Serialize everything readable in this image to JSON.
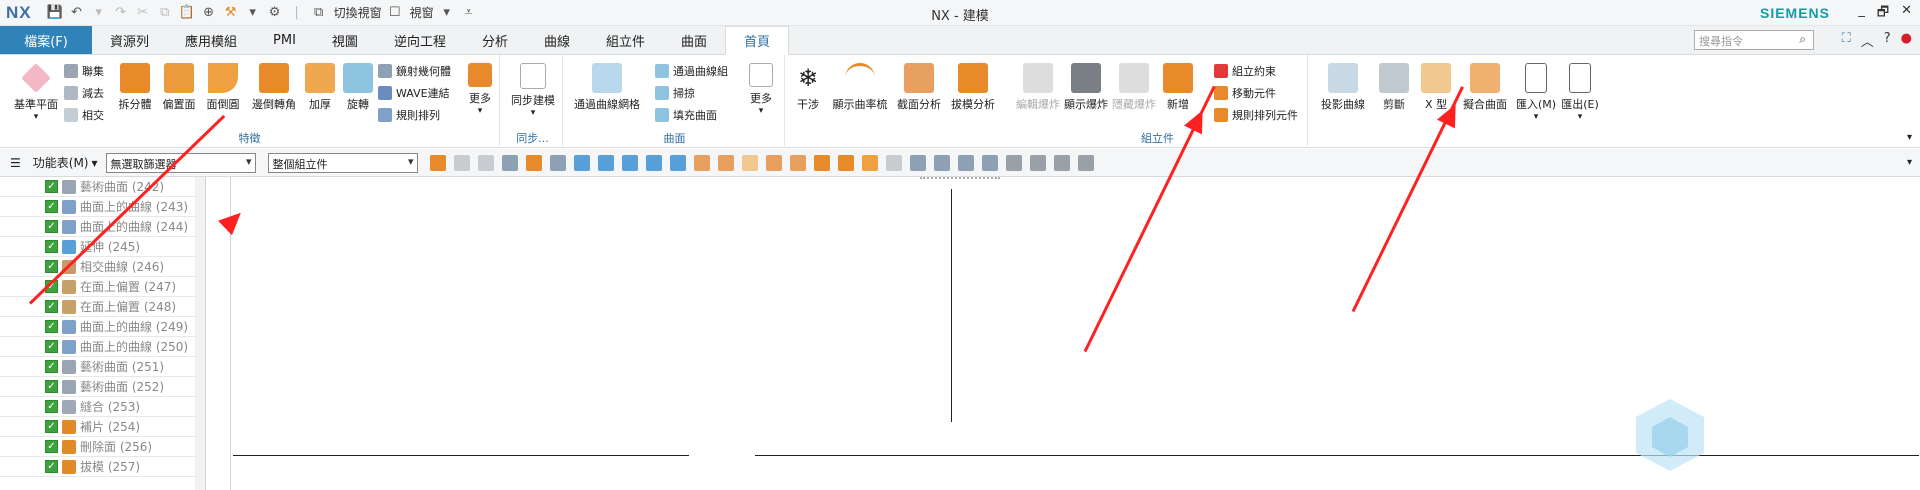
{
  "titlebar": {
    "logo": "NX",
    "window_title": "NX - 建模",
    "brand": "SIEMENS",
    "switch_window_label": "切換視窗",
    "window_menu_label": "視窗",
    "controls": [
      "_",
      "🗗",
      "✕"
    ]
  },
  "tabs": {
    "file": "檔案(F)",
    "items": [
      "資源列",
      "應用模組",
      "PMI",
      "視圖",
      "逆向工程",
      "分析",
      "曲線",
      "組立件",
      "曲面",
      "首頁"
    ],
    "active": "首頁",
    "search_placeholder": "搜尋指令"
  },
  "ribbon": {
    "features": {
      "label": "特徵",
      "datum_plane": "基準平面",
      "unite": "聯集",
      "subtract": "減去",
      "intersect": "相交",
      "split_body": "拆分體",
      "offset_face": "偏置面",
      "chamfer": "面倒圓",
      "edge_blend": "邊倒轉角",
      "thicken": "加厚",
      "revolve": "旋轉",
      "extract_geometry": "鏡射幾何體",
      "wave_link": "WAVE連結",
      "pattern": "規則排列",
      "more": "更多"
    },
    "sync": {
      "label": "同步...",
      "sync_modeling": "同步建模"
    },
    "surface": {
      "label": "曲面",
      "through_curve_mesh": "通過曲線網格",
      "through_curves": "通過曲線組",
      "sweep": "掃掠",
      "fill_surface": "填充曲面",
      "more": "更多"
    },
    "analysis": {
      "interference": "干涉",
      "curvature_comb": "顯示曲率梳",
      "section_analysis": "截面分析",
      "draft_analysis": "拔模分析"
    },
    "assembly": {
      "label": "組立件",
      "edit_explosion": "編輯爆炸",
      "show_explosion": "顯示爆炸",
      "hide_explosion": "隱藏爆炸",
      "new": "新增",
      "assembly_constraint": "組立約束",
      "move_component": "移動元件",
      "pattern_component": "規則排列元件"
    },
    "misc": {
      "project_curve": "投影曲線",
      "trim": "剪斷",
      "x_form": "X 型",
      "fit_surface": "擬合曲面",
      "import": "匯入(M)",
      "export": "匯出(E)"
    }
  },
  "toolbar2": {
    "menu_label": "功能表(M)",
    "filter": "無選取篩選器",
    "scope": "整個組立件"
  },
  "tree": {
    "rows": [
      {
        "label": "藝術曲面 (242)",
        "color": "#9aa4b2"
      },
      {
        "label": "曲面上的曲線 (243)",
        "color": "#7fa0c8"
      },
      {
        "label": "曲面上的曲線 (244)",
        "color": "#7fa0c8"
      },
      {
        "label": "延伸 (245)",
        "color": "#5aa0d8"
      },
      {
        "label": "相交曲線 (246)",
        "color": "#c89a6a"
      },
      {
        "label": "在面上偏置 (247)",
        "color": "#c8a06a"
      },
      {
        "label": "在面上偏置 (248)",
        "color": "#c8a06a"
      },
      {
        "label": "曲面上的曲線 (249)",
        "color": "#7fa0c8"
      },
      {
        "label": "曲面上的曲線 (250)",
        "color": "#7fa0c8"
      },
      {
        "label": "藝術曲面 (251)",
        "color": "#9aa4b2"
      },
      {
        "label": "藝術曲面 (252)",
        "color": "#9aa4b2"
      },
      {
        "label": "縫合 (253)",
        "color": "#a0a8b8"
      },
      {
        "label": "補片 (254)",
        "color": "#e08a2a"
      },
      {
        "label": "刪除面 (256)",
        "color": "#e08a2a"
      },
      {
        "label": "拔模 (257)",
        "color": "#e08a2a"
      }
    ]
  },
  "colors": {
    "accent": "#2f83b8",
    "arrow": "#ff2020",
    "active_tab_text": "#2f6fa5"
  }
}
